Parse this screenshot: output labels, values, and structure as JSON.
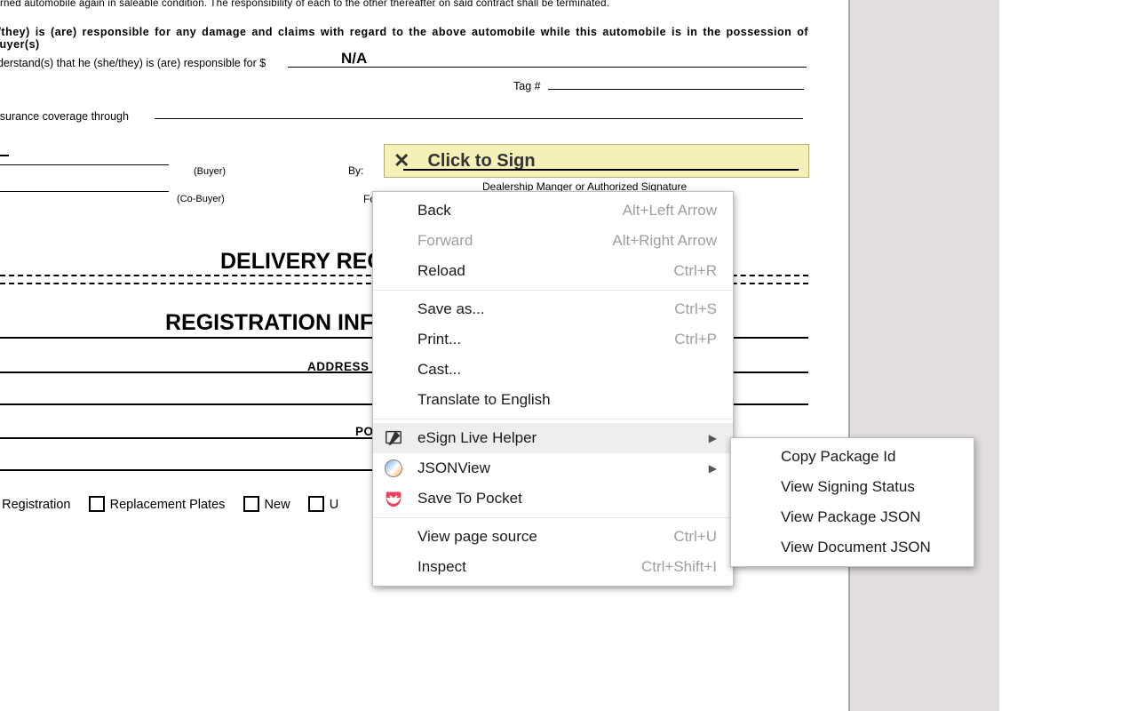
{
  "doc": {
    "line1_text": "turned automobile again in saleable condition. The responsibility of each to the other thereafter on said contract shall be terminated.",
    "line2_text": "e/they) is (are) responsible for any damage and claims with regard to the above automobile while this automobile is in the possession of Buyer(s)",
    "line3_text": "nderstand(s) that he (she/they) is (are) responsible for $",
    "na_value": "N/A",
    "tag_label": "Tag #",
    "insurance_label": " insurance coverage through",
    "buyer_label": "(Buyer)",
    "cobuyer_label": "(Co-Buyer)",
    "by_label": "By:",
    "for_label": "For:",
    "sign_cta": "Click to Sign",
    "dealer_signature_label": "Dealership Manger or Authorized Signature",
    "heading_delivery": "DELIVERY REC",
    "heading_registration": "REGISTRATION INFO",
    "address_label": "ADDRESS",
    "po_label": "PO",
    "chk_registration": "e Registration",
    "chk_replacement": "Replacement Plates",
    "chk_new": "New",
    "chk_u": "U"
  },
  "context_menu": {
    "back": {
      "label": "Back",
      "kbd": "Alt+Left Arrow"
    },
    "forward": {
      "label": "Forward",
      "kbd": "Alt+Right Arrow"
    },
    "reload": {
      "label": "Reload",
      "kbd": "Ctrl+R"
    },
    "save_as": {
      "label": "Save as...",
      "kbd": "Ctrl+S"
    },
    "print": {
      "label": "Print...",
      "kbd": "Ctrl+P"
    },
    "cast": {
      "label": "Cast..."
    },
    "translate": {
      "label": "Translate to English"
    },
    "esign": {
      "label": "eSign Live Helper"
    },
    "jsonview": {
      "label": "JSONView"
    },
    "pocket": {
      "label": "Save To Pocket"
    },
    "view_source": {
      "label": "View page source",
      "kbd": "Ctrl+U"
    },
    "inspect": {
      "label": "Inspect",
      "kbd": "Ctrl+Shift+I"
    }
  },
  "submenu": {
    "copy_pkg": "Copy Package Id",
    "view_status": "View Signing Status",
    "view_pkg_json": "View Package JSON",
    "view_doc_json": "View Document JSON"
  }
}
